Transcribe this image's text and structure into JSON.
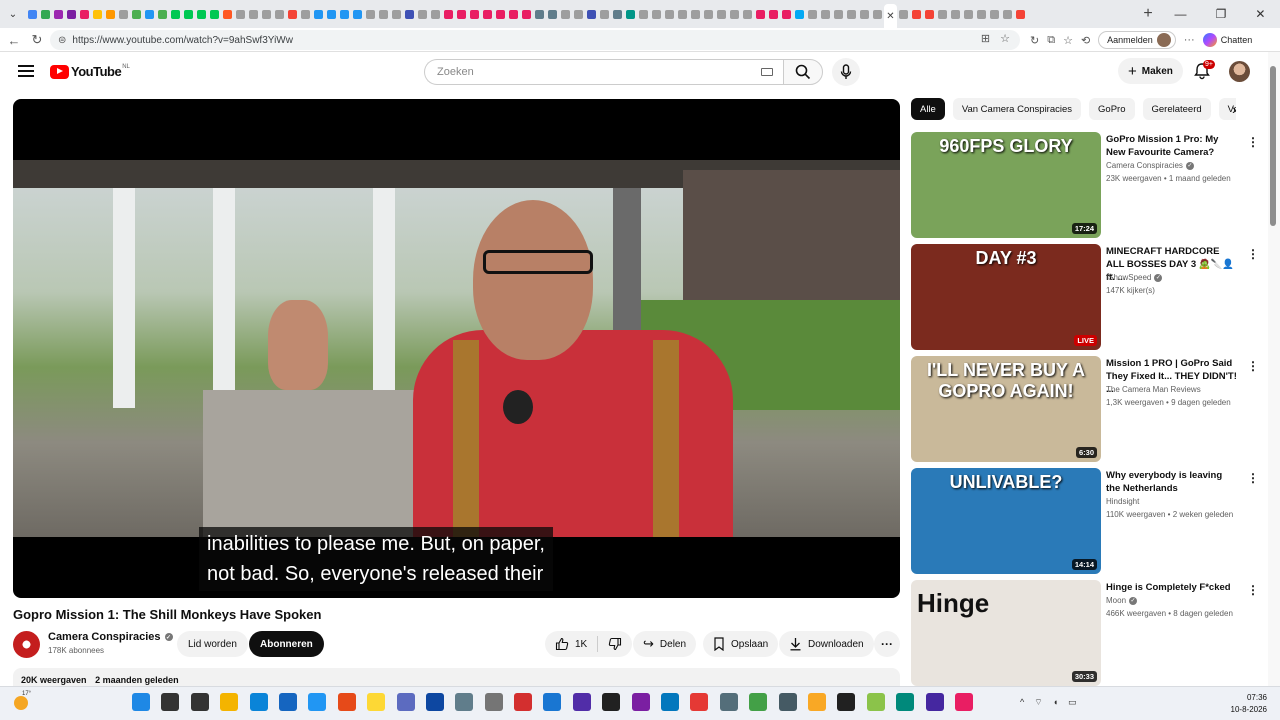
{
  "browser": {
    "url": "https://www.youtube.com/watch?v=9ahSwf3YiWw",
    "signin_label": "Aanmelden",
    "copilot_label": "Chatten",
    "favicon_colors": [
      "#4285f4",
      "#34a853",
      "#9c27b0",
      "#7b1fa2",
      "#e91e63",
      "#ffc107",
      "#ff9800",
      "#9e9e9e",
      "#4caf50",
      "#2196f3",
      "#4caf50",
      "#00c853",
      "#00c853",
      "#00c853",
      "#00c853",
      "#ff5722",
      "#9e9e9e",
      "#9e9e9e",
      "#9e9e9e",
      "#9e9e9e",
      "#f44336",
      "#9e9e9e",
      "#2196f3",
      "#2196f3",
      "#2196f3",
      "#2196f3",
      "#9e9e9e",
      "#9e9e9e",
      "#9e9e9e",
      "#3f51b5",
      "#9e9e9e",
      "#9e9e9e",
      "#e91e63",
      "#e91e63",
      "#e91e63",
      "#e91e63",
      "#e91e63",
      "#e91e63",
      "#e91e63",
      "#607d8b",
      "#607d8b",
      "#9e9e9e",
      "#9e9e9e",
      "#3f51b5",
      "#9e9e9e",
      "#607d8b",
      "#009688",
      "#9e9e9e",
      "#9e9e9e",
      "#9e9e9e",
      "#9e9e9e",
      "#9e9e9e",
      "#9e9e9e",
      "#9e9e9e",
      "#9e9e9e",
      "#9e9e9e",
      "#e91e63",
      "#e91e63",
      "#e91e63",
      "#03a9f4",
      "#9e9e9e",
      "#9e9e9e",
      "#9e9e9e",
      "#9e9e9e",
      "#9e9e9e",
      "#9e9e9e",
      "#9e9e9e",
      "#f44336",
      "#f44336",
      "#9e9e9e",
      "#9e9e9e",
      "#9e9e9e",
      "#9e9e9e",
      "#9e9e9e",
      "#9e9e9e",
      "#f44336"
    ]
  },
  "youtube": {
    "logo_text": "YouTube",
    "logo_country": "NL",
    "search_placeholder": "Zoeken",
    "create_label": "Maken",
    "notifications_badge": "9+"
  },
  "player": {
    "caption_line1": "inabilities to please me. But, on paper,",
    "caption_line2": "not bad. So, everyone's released their"
  },
  "video": {
    "title": "Gopro Mission 1: The Shill Monkeys Have Spoken",
    "channel": "Camera Conspiracies",
    "subscribers": "178K abonnees",
    "join_label": "Lid worden",
    "subscribe_label": "Abonneren",
    "likes": "1K",
    "share_label": "Delen",
    "save_label": "Opslaan",
    "download_label": "Downloaden",
    "views": "20K weergaven",
    "age": "2 maanden geleden"
  },
  "chips": [
    "Alle",
    "Van Camera Conspiracies",
    "GoPro",
    "Gerelateerd",
    "Voor"
  ],
  "recommendations": [
    {
      "title": "GoPro Mission 1 Pro: My New Favourite Camera?",
      "channel": "Camera Conspiracies",
      "verified": true,
      "meta": "23K weergaven • 1 maand geleden",
      "duration": "17:24",
      "thumb_text": "960FPS GLORY",
      "thumb_bg": "#7aa35a"
    },
    {
      "title": "MINECRAFT HARDCORE ALL BOSSES DAY 3 🧟🔪👤ft. ...",
      "channel": "IShowSpeed",
      "verified": true,
      "meta": "147K kijker(s)",
      "duration": "LIVE",
      "thumb_text": "DAY #3",
      "thumb_bg": "#7b2a1e"
    },
    {
      "title": "Mission 1 PRO | GoPro Said They Fixed It... THEY DIDN'T! ...",
      "channel": "The Camera Man Reviews",
      "verified": false,
      "meta": "1,3K weergaven • 9 dagen geleden",
      "duration": "6:30",
      "thumb_text": "I'LL NEVER BUY A GOPRO AGAIN!",
      "thumb_bg": "#c9b99a"
    },
    {
      "title": "Why everybody is leaving the Netherlands",
      "channel": "Hindsight",
      "verified": false,
      "meta": "110K weergaven • 2 weken geleden",
      "duration": "14:14",
      "thumb_text": "UNLIVABLE?",
      "thumb_bg": "#2a7ab8"
    },
    {
      "title": "Hinge is Completely F*cked",
      "channel": "Moon",
      "verified": true,
      "meta": "466K weergaven • 8 dagen geleden",
      "duration": "30:33",
      "thumb_text": "Hinge",
      "thumb_bg": "#e9e4de"
    }
  ],
  "taskbar": {
    "temperature": "17°",
    "time": "07:36",
    "date": "10-8-2026",
    "icon_colors": [
      "#1e88e5",
      "#333333",
      "#333333",
      "#f4b400",
      "#0a84d8",
      "#1565c0",
      "#2196f3",
      "#e64a19",
      "#fdd835",
      "#5c6bc0",
      "#0d47a1",
      "#607d8b",
      "#757575",
      "#d32f2f",
      "#1976d2",
      "#512da8",
      "#212121",
      "#7b1fa2",
      "#0277bd",
      "#e53935",
      "#546e7a",
      "#43a047",
      "#455a64",
      "#f9a825",
      "#212121",
      "#8bc34a",
      "#00897b",
      "#4527a0",
      "#e91e63"
    ]
  }
}
